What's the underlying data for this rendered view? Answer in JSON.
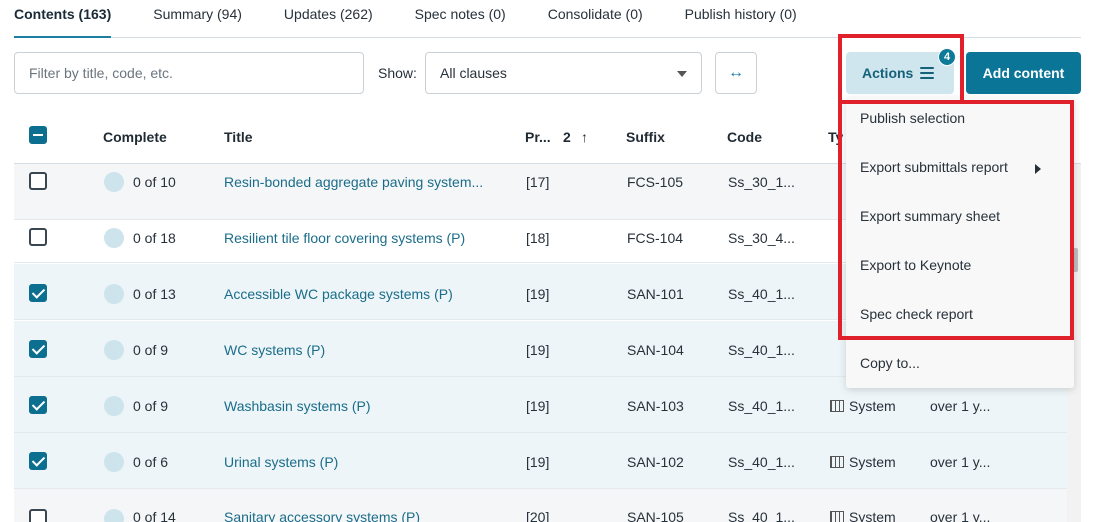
{
  "tabs": [
    {
      "label": "Contents (163)",
      "active": true
    },
    {
      "label": "Summary (94)"
    },
    {
      "label": "Updates (262)"
    },
    {
      "label": "Spec notes (0)"
    },
    {
      "label": "Consolidate (0)"
    },
    {
      "label": "Publish history (0)"
    }
  ],
  "toolbar": {
    "filter_placeholder": "Filter by title, code, etc.",
    "show_label": "Show:",
    "show_value": "All clauses",
    "expand_icon": "↔",
    "actions_label": "Actions",
    "actions_badge": "4",
    "add_label": "Add content"
  },
  "table": {
    "headers": {
      "complete": "Complete",
      "title": "Title",
      "pr": "Pr...",
      "sort_index": "2",
      "suffix": "Suffix",
      "code": "Code",
      "type": "Ty"
    },
    "rows": [
      {
        "checked": false,
        "complete": "0 of 10",
        "title": "Resin-bonded aggregate paving system...",
        "pr": "[17]",
        "suffix": "FCS-105",
        "code": "Ss_30_1...",
        "type": "",
        "updated": ""
      },
      {
        "checked": false,
        "complete": "0 of 18",
        "title": "Resilient tile floor covering systems (P)",
        "pr": "[18]",
        "suffix": "FCS-104",
        "code": "Ss_30_4...",
        "type": "",
        "updated": ""
      },
      {
        "checked": true,
        "complete": "0 of 13",
        "title": "Accessible WC package systems (P)",
        "pr": "[19]",
        "suffix": "SAN-101",
        "code": "Ss_40_1...",
        "type": "",
        "updated": ""
      },
      {
        "checked": true,
        "complete": "0 of 9",
        "title": "WC systems (P)",
        "pr": "[19]",
        "suffix": "SAN-104",
        "code": "Ss_40_1...",
        "type": "",
        "updated": ""
      },
      {
        "checked": true,
        "complete": "0 of 9",
        "title": "Washbasin systems (P)",
        "pr": "[19]",
        "suffix": "SAN-103",
        "code": "Ss_40_1...",
        "type": "System",
        "updated": "over 1 y..."
      },
      {
        "checked": true,
        "complete": "0 of 6",
        "title": "Urinal systems (P)",
        "pr": "[19]",
        "suffix": "SAN-102",
        "code": "Ss_40_1...",
        "type": "System",
        "updated": "over 1 y..."
      },
      {
        "checked": false,
        "complete": "0 of 14",
        "title": "Sanitary accessory systems (P)",
        "pr": "[20]",
        "suffix": "SAN-105",
        "code": "Ss_40_1...",
        "type": "System",
        "updated": "over 1 y..."
      }
    ]
  },
  "actions_menu": {
    "items": [
      "Publish selection",
      "Export submittals report",
      "Export summary sheet",
      "Export to Keynote",
      "Spec check report",
      "Copy to..."
    ]
  },
  "colors": {
    "accent": "#0b7597",
    "link": "#1a6d8a",
    "highlight": "#e0202a",
    "selected_row": "#edf5f8"
  }
}
